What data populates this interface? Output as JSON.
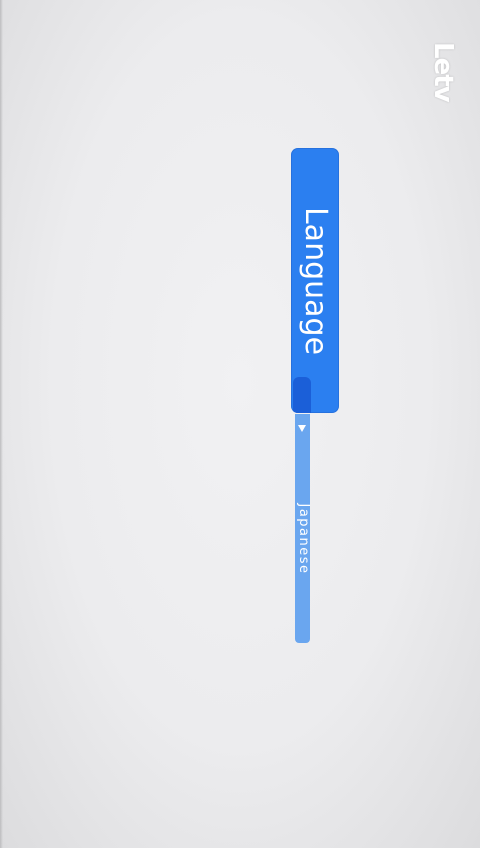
{
  "brand": {
    "logo_text": "Letv"
  },
  "language": {
    "button_label": "Language",
    "selected_value": "Japanese"
  },
  "colors": {
    "accent": "#2b7ff0",
    "accent_dark": "#1b5fd8",
    "dropdown": "#6aa6ef",
    "background": "#ececee"
  }
}
